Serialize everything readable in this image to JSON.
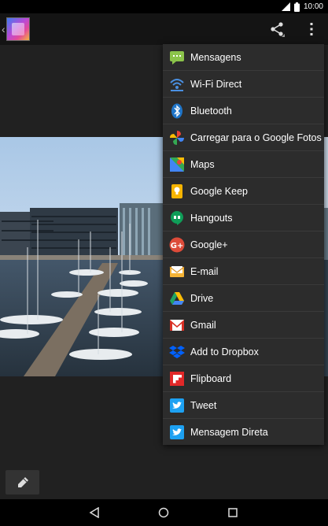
{
  "status_bar": {
    "time": "10:00",
    "icons": [
      "signal-icon",
      "battery-icon"
    ]
  },
  "action_bar": {
    "up_icon": "chevron-left-icon",
    "app_icon": "gallery-app-icon",
    "share_icon": "share-icon",
    "overflow_icon": "more-vert-icon"
  },
  "share_menu": {
    "items": [
      {
        "label": "Mensagens",
        "icon": "messages-icon",
        "color": "#8bc34a"
      },
      {
        "label": "Wi-Fi Direct",
        "icon": "wifi-direct-icon",
        "color": "#4a90e2"
      },
      {
        "label": "Bluetooth",
        "icon": "bluetooth-icon",
        "color": "#1f75c9"
      },
      {
        "label": "Carregar para o Google Fotos",
        "icon": "google-photos-icon",
        "color": "#ea4335"
      },
      {
        "label": "Maps",
        "icon": "maps-icon",
        "color": "#34a853"
      },
      {
        "label": "Google Keep",
        "icon": "keep-icon",
        "color": "#f6b400"
      },
      {
        "label": "Hangouts",
        "icon": "hangouts-icon",
        "color": "#0f9d58"
      },
      {
        "label": "Google+",
        "icon": "google-plus-icon",
        "color": "#dd4b39"
      },
      {
        "label": "E-mail",
        "icon": "email-icon",
        "color": "#f5b335"
      },
      {
        "label": "Drive",
        "icon": "drive-icon",
        "color": "#1fa463"
      },
      {
        "label": "Gmail",
        "icon": "gmail-icon",
        "color": "#d93025"
      },
      {
        "label": "Add to Dropbox",
        "icon": "dropbox-icon",
        "color": "#0061ff"
      },
      {
        "label": "Flipboard",
        "icon": "flipboard-icon",
        "color": "#e12828"
      },
      {
        "label": "Tweet",
        "icon": "twitter-icon",
        "color": "#1da1f2"
      },
      {
        "label": "Mensagem Direta",
        "icon": "twitter-dm-icon",
        "color": "#1da1f2"
      }
    ]
  },
  "bottom": {
    "edit_icon": "pencil-icon"
  },
  "nav_bar": {
    "back_icon": "back-icon",
    "home_icon": "home-icon",
    "recents_icon": "recents-icon"
  }
}
